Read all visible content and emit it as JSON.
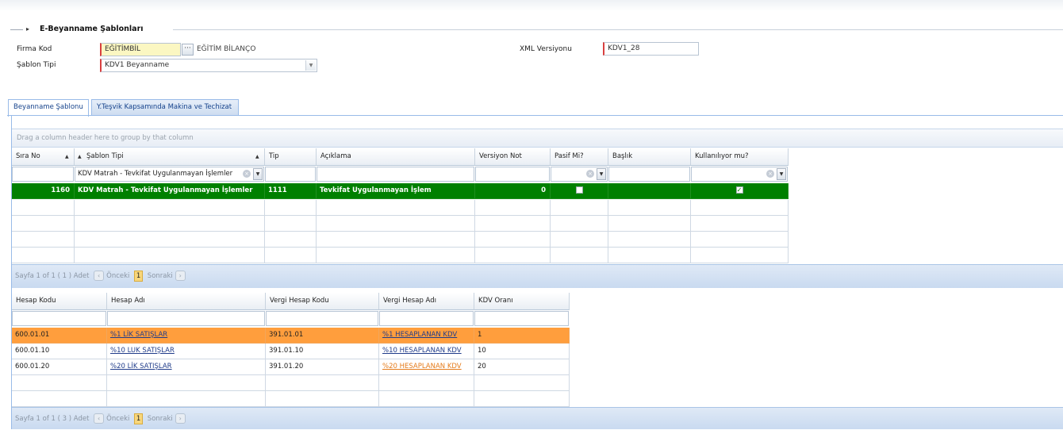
{
  "section": {
    "title": "E-Beyanname Şablonları"
  },
  "form": {
    "firma_kod_label": "Firma Kod",
    "firma_kod_value": "EĞİTİMBİL",
    "firma_ad": "EĞİTİM BİLANÇO",
    "sablon_tipi_label": "Şablon Tipi",
    "sablon_tipi_value": "KDV1 Beyanname",
    "xml_versiyon_label": "XML Versiyonu",
    "xml_versiyon_value": "KDV1_28",
    "ellipsis": "···"
  },
  "tabs": [
    {
      "label": "Beyanname Şablonu",
      "active": true
    },
    {
      "label": "Y.Teşvik Kapsamında Makina ve Techizat",
      "active": false
    }
  ],
  "grid1": {
    "group_hint": "Drag a column header here to group by that column",
    "columns": [
      "Sıra No",
      "Şablon Tipi",
      "Tip",
      "Açıklama",
      "Versiyon Not",
      "Pasif Mi?",
      "Başlık",
      "Kullanılıyor mu?"
    ],
    "filter_sablon_tipi": "KDV Matrah - Tevkifat Uygulanmayan İşlemler",
    "rows": [
      {
        "sira_no": "1160",
        "sablon_tipi": "KDV Matrah - Tevkifat Uygulanmayan İşlemler",
        "tip": "1111",
        "aciklama": "Tevkifat Uygulanmayan İşlem",
        "versiyon_not": "0",
        "pasif": false,
        "baslik": "",
        "kullaniliyor": true
      }
    ],
    "pager": {
      "info": "Sayfa 1 of 1 ( 1 ) Adet",
      "prev": "Önceki",
      "page": "1",
      "next": "Sonraki"
    }
  },
  "grid2": {
    "columns": [
      "Hesap Kodu",
      "Hesap Adı",
      "Vergi Hesap Kodu",
      "Vergi Hesap Adı",
      "KDV Oranı"
    ],
    "rows": [
      {
        "hesap_kodu": "600.01.01",
        "hesap_adi": "%1 LİK SATIŞLAR",
        "vergi_hesap_kodu": "391.01.01",
        "vergi_hesap_adi": "%1 HESAPLANAN KDV",
        "kdv_orani": "1"
      },
      {
        "hesap_kodu": "600.01.10",
        "hesap_adi": "%10 LUK SATIŞLAR",
        "vergi_hesap_kodu": "391.01.10",
        "vergi_hesap_adi": "%10 HESAPLANAN KDV",
        "kdv_orani": "10"
      },
      {
        "hesap_kodu": "600.01.20",
        "hesap_adi": "%20 LİK SATIŞLAR",
        "vergi_hesap_kodu": "391.01.20",
        "vergi_hesap_adi": "%20 HESAPLANAN KDV",
        "kdv_orani": "20"
      }
    ],
    "pager": {
      "info": "Sayfa 1 of 1 ( 3 ) Adet",
      "prev": "Önceki",
      "page": "1",
      "next": "Sonraki"
    }
  },
  "colors": {
    "selected_row": "#008000",
    "highlight_row": "#ff9e3d",
    "link": "#203c8a",
    "link_alt": "#e57b1a"
  }
}
